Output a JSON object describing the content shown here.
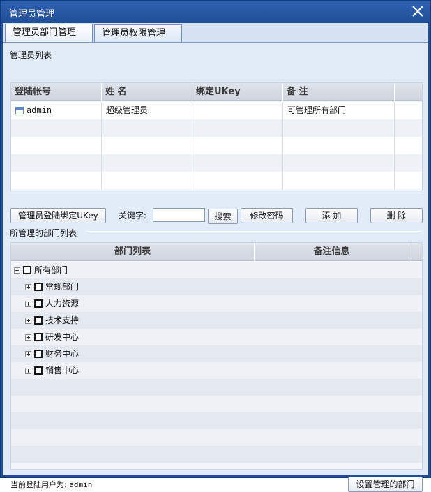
{
  "window": {
    "title": "管理员管理"
  },
  "tabs": [
    {
      "label": "管理员部门管理"
    },
    {
      "label": "管理员权限管理"
    }
  ],
  "admin_list": {
    "section_label": "管理员列表",
    "columns": [
      "登陆帐号",
      "姓 名",
      "绑定UKey",
      "备 注"
    ],
    "rows": [
      {
        "account": "admin",
        "name": "超级管理员",
        "ukey": "",
        "note": "可管理所有部门"
      }
    ]
  },
  "toolbar": {
    "bind_ukey_label": "管理员登陆绑定UKey",
    "keyword_label": "关键字:",
    "keyword_value": "",
    "search_label": "搜索",
    "change_password_label": "修改密码",
    "add_label": "添 加",
    "delete_label": "删 除"
  },
  "dept_list": {
    "section_label": "所管理的部门列表",
    "columns": [
      "部门列表",
      "备注信息"
    ],
    "root": "所有部门",
    "children": [
      "常规部门",
      "人力资源",
      "技术支持",
      "研发中心",
      "财务中心",
      "销售中心"
    ]
  },
  "status": {
    "current_user_label": "当前登陆用户为:",
    "current_user": "admin"
  },
  "footer": {
    "set_dept_label": "设置管理的部门"
  },
  "colors": {
    "titlebar": "#214f98",
    "panel": "#e2ecf9"
  }
}
